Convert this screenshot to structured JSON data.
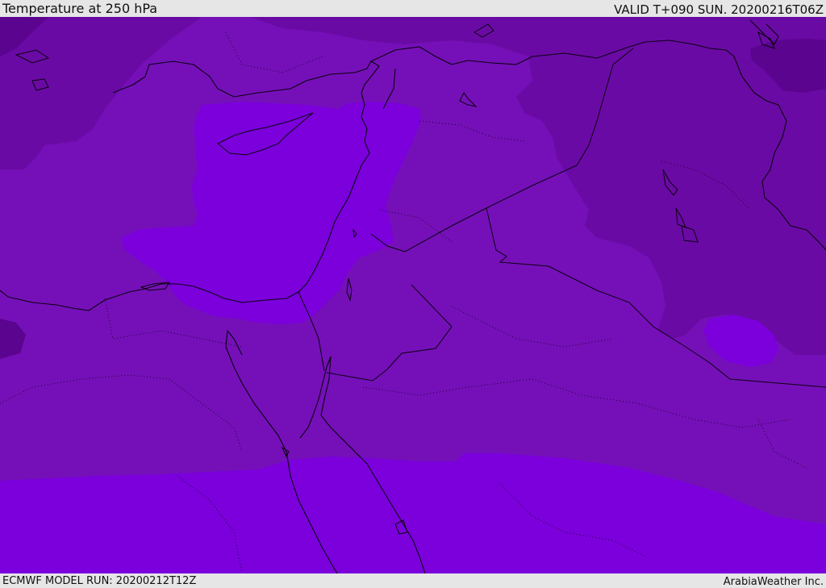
{
  "header": {
    "title": "Temperature at 250 hPa",
    "valid_time": "VALID T+090 SUN. 20200216T06Z"
  },
  "footer": {
    "model_run": "ECMWF MODEL RUN: 20200212T12Z",
    "credit": "ArabiaWeather Inc."
  },
  "map": {
    "field": "temperature_250hPa",
    "colors": {
      "warmest_band": "#7b00dc",
      "mid_band": "#7510b8",
      "cool_band": "#6a0aa4",
      "coldest_band": "#5a0490",
      "coastline": "#0a0010"
    }
  }
}
